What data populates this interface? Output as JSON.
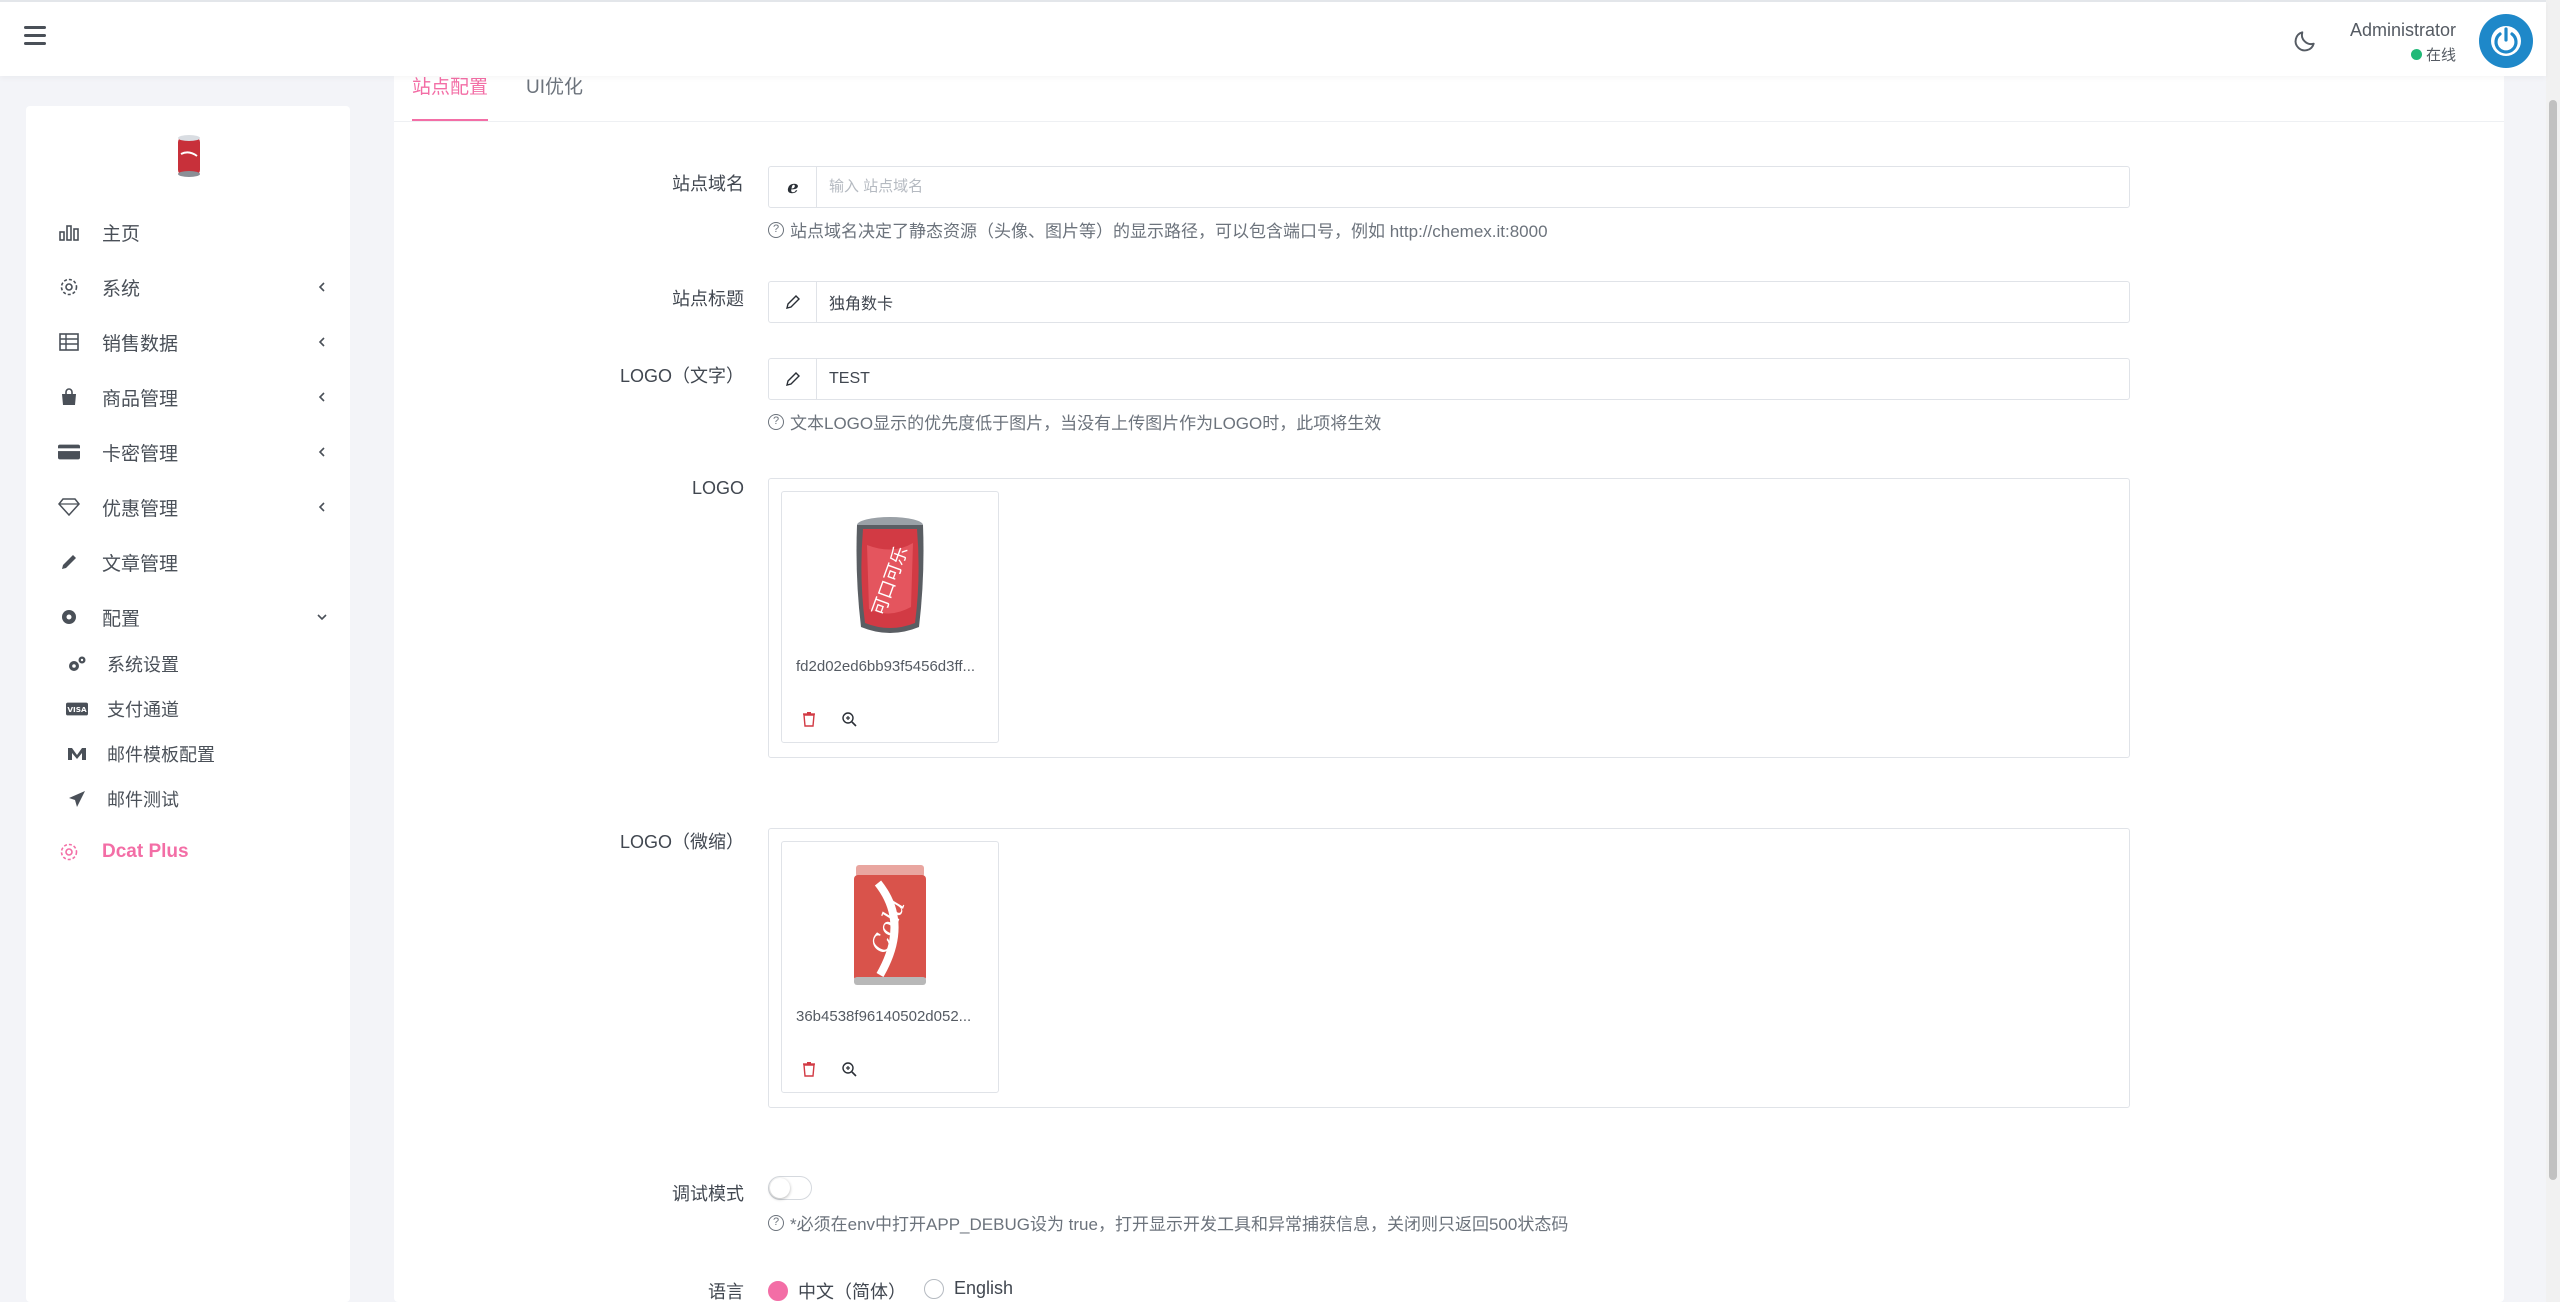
{
  "header": {
    "menu_icon": "hamburger-icon",
    "theme_icon": "moon-icon",
    "user_name": "Administrator",
    "user_status": "在线",
    "status_color": "#21b978",
    "avatar_color": "#1e88c9"
  },
  "sidebar": {
    "items": [
      {
        "label": "主页",
        "icon": "bar-chart-icon"
      },
      {
        "label": "系统",
        "icon": "gear-icon"
      },
      {
        "label": "销售数据",
        "icon": "table-icon"
      },
      {
        "label": "商品管理",
        "icon": "shopping-bag-icon"
      },
      {
        "label": "卡密管理",
        "icon": "credit-card-icon"
      },
      {
        "label": "优惠管理",
        "icon": "diamond-icon"
      },
      {
        "label": "文章管理",
        "icon": "pencil-icon"
      },
      {
        "label": "配置",
        "icon": "cog-icon"
      }
    ],
    "sub_items": [
      {
        "label": "系统设置",
        "icon": "cogs-icon"
      },
      {
        "label": "支付通道",
        "icon": "visa-icon"
      },
      {
        "label": "邮件模板配置",
        "icon": "mail-template-icon"
      },
      {
        "label": "邮件测试",
        "icon": "paper-plane-icon"
      }
    ],
    "active_item": {
      "label": "Dcat Plus",
      "icon": "gear-icon"
    },
    "accent_color": "#f36ea6"
  },
  "tabs": [
    {
      "label": "站点配置",
      "active": true
    },
    {
      "label": "UI优化",
      "active": false
    }
  ],
  "form": {
    "site_domain": {
      "label": "站点域名",
      "placeholder": "输入 站点域名",
      "value": "",
      "help": "站点域名决定了静态资源（头像、图片等）的显示路径，可以包含端口号，例如 http://chemex.it:8000"
    },
    "site_title": {
      "label": "站点标题",
      "value": "独角数卡"
    },
    "logo_text": {
      "label": "LOGO（文字）",
      "value": "TEST",
      "help": "文本LOGO显示的优先度低于图片，当没有上传图片作为LOGO时，此项将生效"
    },
    "logo": {
      "label": "LOGO",
      "file_name": "fd2d02ed6bb93f5456d3ff..."
    },
    "logo_thumb": {
      "label": "LOGO（微缩）",
      "file_name": "36b4538f96140502d052..."
    },
    "debug": {
      "label": "调试模式",
      "enabled": false,
      "help": "*必须在env中打开APP_DEBUG设为 true，打开显示开发工具和异常捕获信息，关闭则只返回500状态码"
    },
    "language": {
      "label": "语言",
      "options": [
        {
          "label": "中文（简体）",
          "checked": true
        },
        {
          "label": "English",
          "checked": false
        }
      ]
    }
  }
}
